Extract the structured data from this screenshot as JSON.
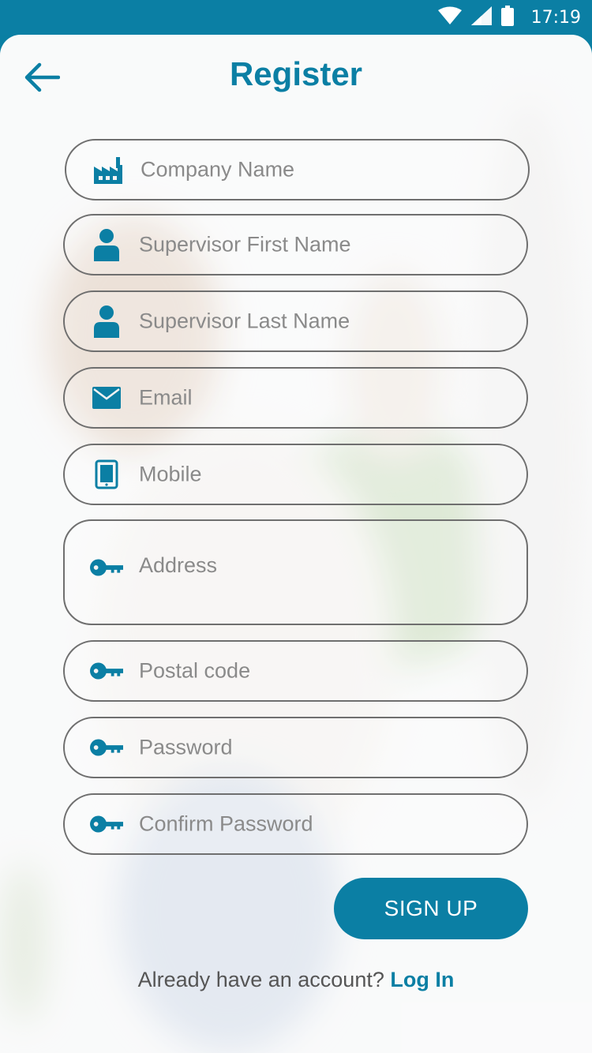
{
  "status_bar": {
    "time": "17:19",
    "icons": [
      "wifi-icon",
      "signal-icon",
      "battery-icon"
    ]
  },
  "header": {
    "title": "Register",
    "back_icon": "arrow-left-icon"
  },
  "form": {
    "fields": [
      {
        "name": "company-name-field",
        "icon": "factory-icon",
        "placeholder": "Company Name"
      },
      {
        "name": "supervisor-first-name-field",
        "icon": "person-icon",
        "placeholder": "Supervisor First Name"
      },
      {
        "name": "supervisor-last-name-field",
        "icon": "person-icon",
        "placeholder": "Supervisor Last Name"
      },
      {
        "name": "email-field",
        "icon": "envelope-icon",
        "placeholder": "Email"
      },
      {
        "name": "mobile-field",
        "icon": "tablet-icon",
        "placeholder": "Mobile"
      },
      {
        "name": "address-field",
        "icon": "key-icon",
        "placeholder": "Address"
      },
      {
        "name": "postal-code-field",
        "icon": "key-icon",
        "placeholder": "Postal code"
      },
      {
        "name": "password-field",
        "icon": "key-icon",
        "placeholder": "Password"
      },
      {
        "name": "confirm-password-field",
        "icon": "key-icon",
        "placeholder": "Confirm Password"
      }
    ],
    "submit_label": "SIGN UP"
  },
  "footer": {
    "prompt": "Already have an account? ",
    "link": "Log In"
  },
  "colors": {
    "accent": "#0b7fa4",
    "border": "#6f6f6f",
    "placeholder": "#8a8a8a"
  }
}
